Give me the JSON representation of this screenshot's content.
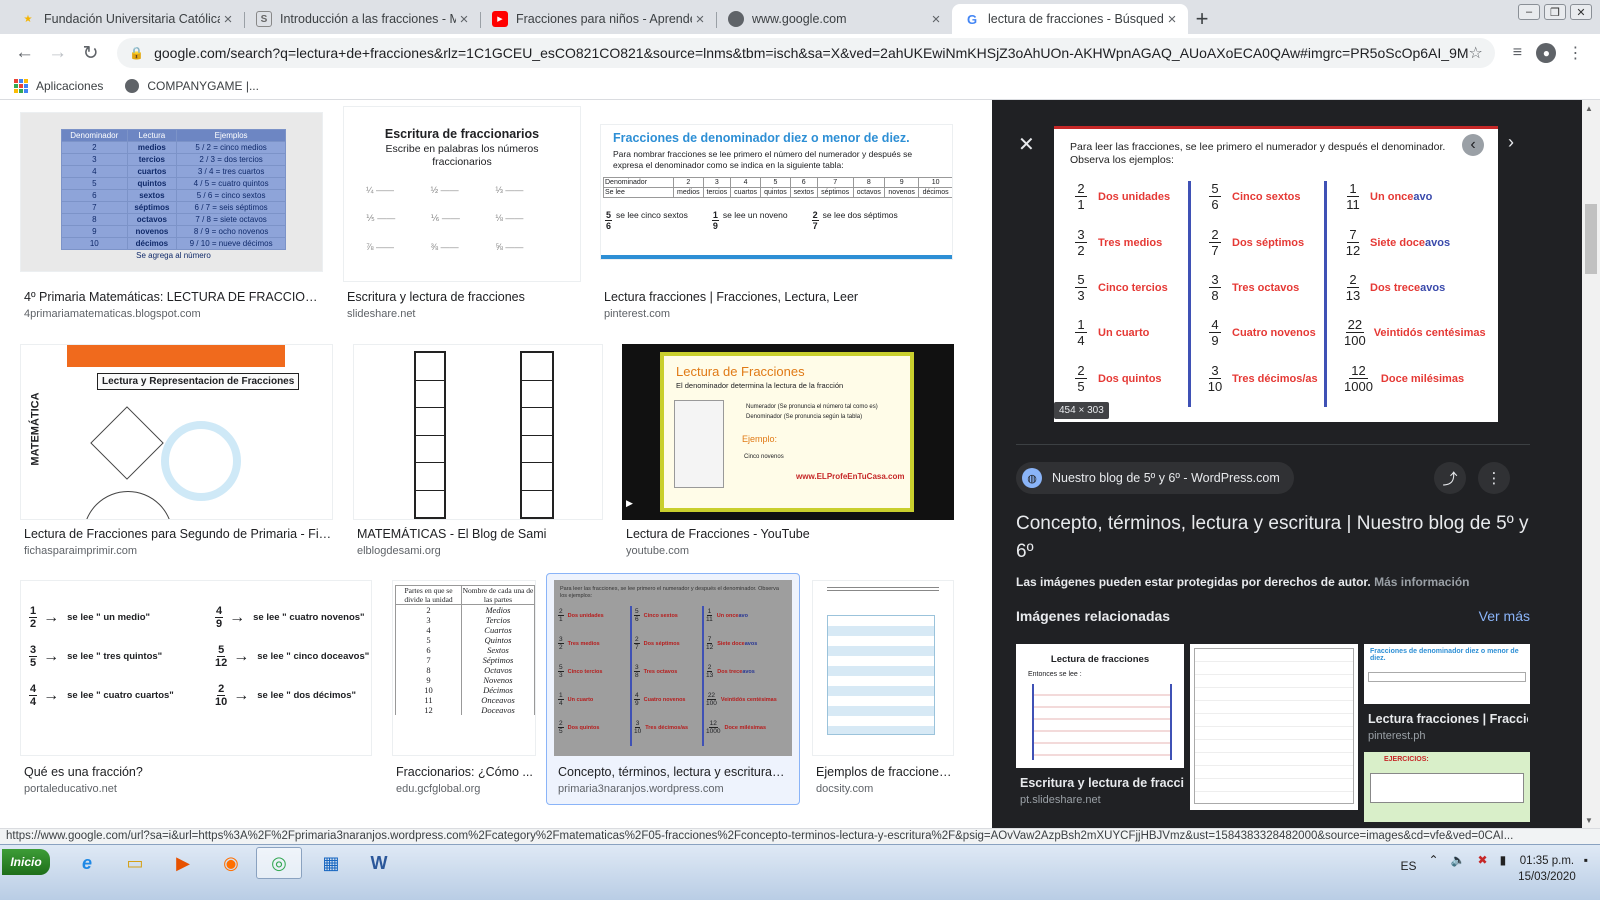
{
  "tabs": [
    {
      "title": "Fundación Universitaria Católica",
      "favicon": "star-favicon-icon",
      "color": "#f4b400"
    },
    {
      "title": "Introducción a las fracciones - M",
      "favicon": "s-favicon-icon",
      "color": "#888888"
    },
    {
      "title": "Fracciones para niños - Aprende",
      "favicon": "youtube-favicon-icon",
      "color": "#ff0000"
    },
    {
      "title": "www.google.com",
      "favicon": "globe-favicon-icon",
      "color": "#5f6368"
    },
    {
      "title": "lectura de fracciones - Búsqueda",
      "favicon": "google-favicon-icon",
      "color": "#4285f4"
    }
  ],
  "toolbar": {
    "url": "google.com/search?q=lectura+de+fracciones&rlz=1C1GCEU_esCO821CO821&source=lnms&tbm=isch&sa=X&ved=2ahUKEwiNmKHSjZ3oAhUOn-AKHWpnAGAQ_AUoAXoECA0QAw#imgrc=PR5oScOp6AI_9M"
  },
  "bookmarks": {
    "apps": "Aplicaciones",
    "companygame": "COMPANYGAME |..."
  },
  "results": [
    {
      "title": "4º Primaria Matemáticas: LECTURA DE FRACCIONES",
      "source": "4primariamatematicas.blogspot.com"
    },
    {
      "title": "Escritura y lectura de fracciones",
      "source": "slideshare.net"
    },
    {
      "title": "Lectura fracciones | Fracciones, Lectura, Leer",
      "source": "pinterest.com"
    },
    {
      "title": "Lectura de Fracciones para Segundo de Primaria - Fich...",
      "source": "fichasparaimprimir.com"
    },
    {
      "title": "MATEMÁTICAS - El Blog de Sami",
      "source": "elblogdesami.org"
    },
    {
      "title": "Lectura de Fracciones - YouTube",
      "source": "youtube.com"
    },
    {
      "title": "Qué es una fracción?",
      "source": "portaleducativo.net"
    },
    {
      "title": "Fraccionarios: ¿Cómo ...",
      "source": "edu.gcfglobal.org"
    },
    {
      "title": "Concepto, términos, lectura y escritura | ...",
      "source": "primaria3naranjos.wordpress.com"
    },
    {
      "title": "Ejemplos de fracciones...",
      "source": "docsity.com"
    }
  ],
  "thumbs": {
    "t1_headers": [
      "Denominador",
      "Lectura",
      "Ejemplos"
    ],
    "t1_rows": [
      [
        "2",
        "medios",
        "5 / 2 = cinco medios"
      ],
      [
        "3",
        "tercios",
        "2 / 3 = dos tercios"
      ],
      [
        "4",
        "cuartos",
        "3 / 4 = tres cuartos"
      ],
      [
        "5",
        "quintos",
        "4 / 5 = cuatro quintos"
      ],
      [
        "6",
        "sextos",
        "5 / 6 = cinco sextos"
      ],
      [
        "7",
        "séptimos",
        "6 / 7 = seis séptimos"
      ],
      [
        "8",
        "octavos",
        "7 / 8 = siete octavos"
      ],
      [
        "9",
        "novenos",
        "8 / 9 = ocho novenos"
      ],
      [
        "10",
        "décimos",
        "9 / 10 = nueve décimos"
      ]
    ],
    "t1_footer": "Se agrega al número",
    "t2_title": "Escritura de fraccionarios",
    "t2_sub": "Escribe en palabras los números fraccionarios",
    "t3_title": "Fracciones de denominador diez o menor de diez.",
    "t3_text": "Para nombrar fracciones se lee primero el número del numerador y después se expresa el denominador como se indica en la siguiente tabla:",
    "t3_head": [
      "Denominador",
      "2",
      "3",
      "4",
      "5",
      "6",
      "7",
      "8",
      "9",
      "10"
    ],
    "t3_row": [
      "Se lee",
      "medios",
      "tercios",
      "cuartos",
      "quintos",
      "sextos",
      "séptimos",
      "octavos",
      "novenos",
      "décimos"
    ],
    "t3_ex": [
      "se lee cinco sextos",
      "se lee un noveno",
      "se lee dos séptimos"
    ],
    "t4_banner": "Lectura y Representacion de Fracciones",
    "t4_side": "MATEMÁTICA",
    "t6_title": "Lectura de Fracciones",
    "t6_sub": "El denominador determina la lectura de la fracción",
    "t6_num": "Numerador (Se pronuncia el número tal como es)",
    "t6_den": "Denominador (Se pronuncia según la tabla)",
    "t6_ej": "Ejemplo:",
    "t6_ejtxt": "Cinco novenos",
    "t6_site": "www.ELProfeEnTuCasa.com",
    "t7_items": [
      {
        "n": "1",
        "d": "2",
        "t": "se lee \" un medio\""
      },
      {
        "n": "4",
        "d": "9",
        "t": "se lee \" cuatro novenos\""
      },
      {
        "n": "3",
        "d": "5",
        "t": "se lee \" tres quintos\""
      },
      {
        "n": "5",
        "d": "12",
        "t": "se lee \" cinco doceavos\""
      },
      {
        "n": "4",
        "d": "4",
        "t": "se lee \" cuatro cuartos\""
      },
      {
        "n": "2",
        "d": "10",
        "t": "se lee \" dos décimos\""
      }
    ],
    "t8_head": [
      "Partes en que se divide la unidad",
      "Nombre de cada una de las partes"
    ],
    "t8_rows": [
      [
        "2",
        "Medios"
      ],
      [
        "3",
        "Tercios"
      ],
      [
        "4",
        "Cuartos"
      ],
      [
        "5",
        "Quintos"
      ],
      [
        "6",
        "Sextos"
      ],
      [
        "7",
        "Séptimos"
      ],
      [
        "8",
        "Octavos"
      ],
      [
        "9",
        "Novenos"
      ],
      [
        "10",
        "Décimos"
      ],
      [
        "11",
        "Onceavos"
      ],
      [
        "12",
        "Doceavos"
      ]
    ]
  },
  "panel": {
    "intro": "Para leer las fracciones, se lee primero el numerador y después el denominador. Observa los ejemplos:",
    "fractions": [
      {
        "n": "2",
        "d": "1",
        "w": "Dos unidades",
        "b": ""
      },
      {
        "n": "3",
        "d": "2",
        "w": "Tres medios",
        "b": ""
      },
      {
        "n": "5",
        "d": "3",
        "w": "Cinco tercios",
        "b": ""
      },
      {
        "n": "1",
        "d": "4",
        "w": "Un cuarto",
        "b": ""
      },
      {
        "n": "2",
        "d": "5",
        "w": "Dos quintos",
        "b": ""
      },
      {
        "n": "5",
        "d": "6",
        "w": "Cinco sextos",
        "b": ""
      },
      {
        "n": "2",
        "d": "7",
        "w": "Dos séptimos",
        "b": ""
      },
      {
        "n": "3",
        "d": "8",
        "w": "Tres octavos",
        "b": ""
      },
      {
        "n": "4",
        "d": "9",
        "w": "Cuatro novenos",
        "b": ""
      },
      {
        "n": "3",
        "d": "10",
        "w": "Tres décimos/as",
        "b": ""
      },
      {
        "n": "1",
        "d": "11",
        "w": "Un once",
        "b": "avo"
      },
      {
        "n": "7",
        "d": "12",
        "w": "Siete doce",
        "b": "avos"
      },
      {
        "n": "2",
        "d": "13",
        "w": "Dos trece",
        "b": "avos"
      },
      {
        "n": "22",
        "d": "100",
        "w": "Veintidós centésimas",
        "b": ""
      },
      {
        "n": "12",
        "d": "1000",
        "w": "Doce milésimas",
        "b": ""
      }
    ],
    "dims": "454 × 303",
    "source": "Nuestro blog de 5º y 6º - WordPress.com",
    "title": "Concepto, términos, lectura y escritura | Nuestro blog de 5º y 6º",
    "copyright": "Las imágenes pueden estar protegidas por derechos de autor.",
    "more_info": "Más información",
    "related": "Imágenes relacionadas",
    "ver_mas": "Ver más",
    "rel_items": [
      {
        "title": "Escritura y lectura de fracci...",
        "source": "pt.slideshare.net",
        "img_title": "Lectura de fracciones",
        "img_sub": "Entonces se lee :"
      },
      {
        "title": "",
        "source": "",
        "img_title": "",
        "img_sub": ""
      },
      {
        "title": "Lectura fracciones | Fraccio...",
        "source": "pinterest.ph",
        "img_title": "Fracciones de denominador diez o menor de diez.",
        "img_sub": ""
      }
    ],
    "rel4_text": "EJERCICIOS:"
  },
  "status_url": "https://www.google.com/url?sa=i&url=https%3A%2F%2Fprimaria3naranjos.wordpress.com%2Fcategory%2Fmatematicas%2F05-fracciones%2Fconcepto-terminos-lectura-y-escritura%2F&psig=AOvVaw2AzpBsh2mXUYCFjjHBJVmz&ust=1584383328482000&source=images&cd=vfe&ved=0CAI...",
  "taskbar": {
    "start": "Inicio",
    "lang": "ES",
    "time": "01:35 p.m.",
    "date": "15/03/2020"
  }
}
